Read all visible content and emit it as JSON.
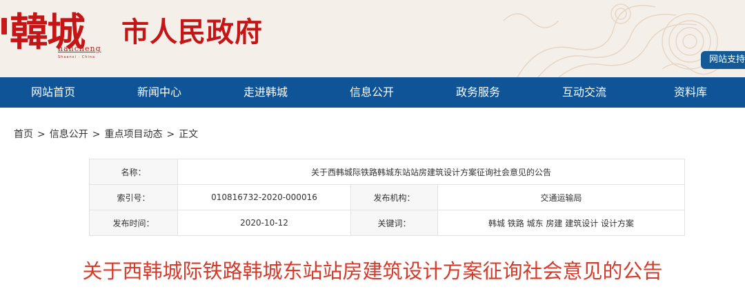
{
  "header": {
    "logo_cn": "韓城",
    "logo_en": "hancheng",
    "logo_en_sub": "Shaanxi · China",
    "logo_gov": "市人民政府",
    "support_label": "网站支持"
  },
  "nav": {
    "items": [
      {
        "label": "网站首页"
      },
      {
        "label": "新闻中心"
      },
      {
        "label": "走进韩城"
      },
      {
        "label": "信息公开"
      },
      {
        "label": "政务服务"
      },
      {
        "label": "互动交流"
      },
      {
        "label": "资料库"
      }
    ]
  },
  "breadcrumb": {
    "items": [
      "首页",
      "信息公开",
      "重点项目动态"
    ],
    "current": "正文",
    "separator": ">"
  },
  "info": {
    "name_label": "名称：",
    "name_value": "关于西韩城际铁路韩城东站站房建筑设计方案征询社会意见的公告",
    "index_label": "索引号：",
    "index_value": "010816732-2020-000016",
    "org_label": "发布机构：",
    "org_value": "交通运输局",
    "date_label": "发布时间：",
    "date_value": "2020-10-12",
    "keywords_label": "关键词：",
    "keywords_value": "韩城 铁路 城东 房建 建筑设计 设计方案"
  },
  "article": {
    "title": "关于西韩城际铁路韩城东站站房建筑设计方案征询社会意见的公告"
  },
  "colors": {
    "nav_bg": "#0f5497",
    "title_red": "#d63a2a",
    "logo_red": "#c41616",
    "header_bg": "#f4efe9"
  }
}
